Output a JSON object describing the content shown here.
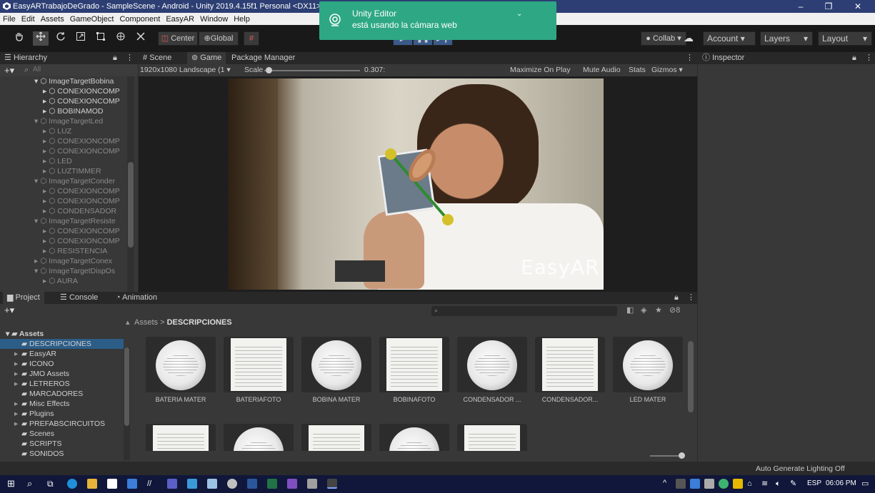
{
  "window": {
    "title": "EasyARTrabajoDeGrado - SampleScene - Android - Unity 2019.4.15f1 Personal <DX11>",
    "minimize": "–",
    "maximize": "❐",
    "close": "✕"
  },
  "menu": [
    "File",
    "Edit",
    "Assets",
    "GameObject",
    "Component",
    "EasyAR",
    "Window",
    "Help"
  ],
  "toast": {
    "title": "Unity Editor",
    "message": "está usando la cámara web"
  },
  "toolbar": {
    "center": "Center",
    "global": "Global",
    "collab": "Collab ▾",
    "account": "Account",
    "layers": "Layers",
    "layout": "Layout"
  },
  "hierarchy": {
    "tab": "Hierarchy",
    "search_placeholder": "All",
    "items": [
      {
        "label": "ImageTargetBobina",
        "depth": 1,
        "expanded": true,
        "active": true
      },
      {
        "label": "CONEXIONCOMP",
        "depth": 2,
        "active": true
      },
      {
        "label": "CONEXIONCOMP",
        "depth": 2,
        "active": true
      },
      {
        "label": "BOBINAMOD",
        "depth": 2,
        "active": true
      },
      {
        "label": "ImageTargetLed",
        "depth": 1,
        "expanded": true,
        "active": false
      },
      {
        "label": "LUZ",
        "depth": 2,
        "active": false
      },
      {
        "label": "CONEXIONCOMP",
        "depth": 2,
        "active": false
      },
      {
        "label": "CONEXIONCOMP",
        "depth": 2,
        "active": false
      },
      {
        "label": "LED",
        "depth": 2,
        "active": false
      },
      {
        "label": "LUZTIMMER",
        "depth": 2,
        "active": false
      },
      {
        "label": "ImageTargetConder",
        "depth": 1,
        "expanded": true,
        "active": false
      },
      {
        "label": "CONEXIONCOMP",
        "depth": 2,
        "active": false
      },
      {
        "label": "CONEXIONCOMP",
        "depth": 2,
        "active": false
      },
      {
        "label": "CONDENSADOR",
        "depth": 2,
        "active": false
      },
      {
        "label": "ImageTargetResiste",
        "depth": 1,
        "expanded": true,
        "active": false
      },
      {
        "label": "CONEXIONCOMP",
        "depth": 2,
        "active": false
      },
      {
        "label": "CONEXIONCOMP",
        "depth": 2,
        "active": false
      },
      {
        "label": "RESISTENCIA",
        "depth": 2,
        "active": false
      },
      {
        "label": "ImageTargetConex",
        "depth": 1,
        "expanded": false,
        "active": false
      },
      {
        "label": "ImageTargetDispOs",
        "depth": 1,
        "expanded": true,
        "active": false
      },
      {
        "label": "AURA",
        "depth": 2,
        "active": false
      }
    ]
  },
  "game": {
    "tabs": [
      "Scene",
      "Game",
      "Package Manager"
    ],
    "resolution": "1920x1080 Landscape (1 ▾",
    "scale_label": "Scale",
    "scale_value": "0.307:",
    "options": [
      "Maximize On Play",
      "Mute Audio",
      "Stats",
      "Gizmos ▾"
    ],
    "watermark": "EasyAR"
  },
  "inspector": {
    "tab": "Inspector"
  },
  "project": {
    "tabs": [
      "Project",
      "Console",
      "Animation"
    ],
    "breadcrumb_root": "Assets",
    "breadcrumb_sep": ">",
    "breadcrumb_current": "DESCRIPCIONES",
    "badge": "8",
    "root": "Assets",
    "folders": [
      {
        "label": "DESCRIPCIONES",
        "selected": true,
        "arrow": false
      },
      {
        "label": "EasyAR",
        "arrow": true
      },
      {
        "label": "ICONO",
        "arrow": true
      },
      {
        "label": "JMO Assets",
        "arrow": true
      },
      {
        "label": "LETREROS",
        "arrow": true
      },
      {
        "label": "MARCADORES",
        "arrow": false
      },
      {
        "label": "Misc Effects",
        "arrow": true
      },
      {
        "label": "Plugins",
        "arrow": true
      },
      {
        "label": "PREFABSCIRCUITOS",
        "arrow": true
      },
      {
        "label": "Scenes",
        "arrow": false
      },
      {
        "label": "SCRIPTS",
        "arrow": false
      },
      {
        "label": "SONIDOS",
        "arrow": false
      }
    ],
    "assets": [
      {
        "label": "BATERIA MATER",
        "kind": "sphere"
      },
      {
        "label": "BATERIAFOTO",
        "kind": "doc"
      },
      {
        "label": "BOBINA MATER",
        "kind": "sphere"
      },
      {
        "label": "BOBINAFOTO",
        "kind": "doc"
      },
      {
        "label": "CONDENSADOR ...",
        "kind": "sphere"
      },
      {
        "label": "CONDENSADOR...",
        "kind": "doc"
      },
      {
        "label": "LED MATER",
        "kind": "sphere"
      },
      {
        "label": "",
        "kind": "doc"
      },
      {
        "label": "",
        "kind": "sphere"
      },
      {
        "label": "",
        "kind": "doc"
      },
      {
        "label": "",
        "kind": "sphere"
      },
      {
        "label": "",
        "kind": "doc"
      }
    ]
  },
  "status": {
    "lighting": "Auto Generate Lighting Off"
  },
  "taskbar": {
    "lang": "ESP",
    "time": "06:06 PM"
  }
}
